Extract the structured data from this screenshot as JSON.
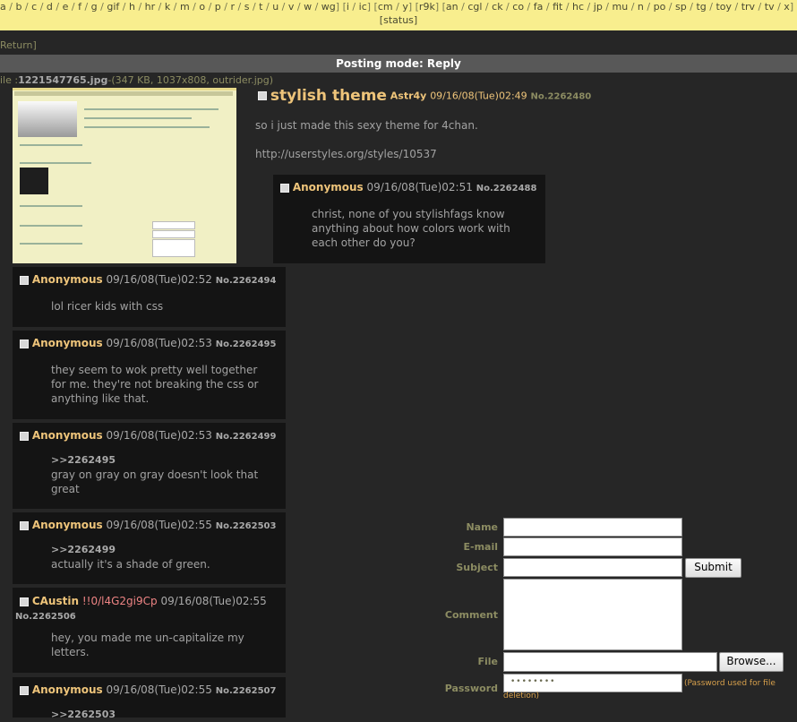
{
  "nav": {
    "boards_row1": [
      "a",
      "b",
      "c",
      "d",
      "e",
      "f",
      "g",
      "gif",
      "h",
      "hr",
      "k",
      "m",
      "o",
      "p",
      "r",
      "s",
      "t",
      "u",
      "v",
      "w",
      "wg",
      "i",
      "ic",
      "cm",
      "y",
      "r9k",
      "an",
      "cgl",
      "ck",
      "co",
      "fa",
      "fit",
      "hc",
      "jp",
      "mu",
      "n",
      "po",
      "sp",
      "tg",
      "toy",
      "trv",
      "tv",
      "x",
      "r"
    ],
    "status": "status"
  },
  "return_link": "Return",
  "mode_bar": "Posting mode: Reply",
  "file": {
    "label": "ile :",
    "name": "1221547765.jpg",
    "info": "-(347 KB, 1037x808, outrider.jpg)"
  },
  "op": {
    "subject": "stylish theme",
    "name": "Astr4y",
    "date": "09/16/08(Tue)02:49",
    "no": "No.2262480",
    "body_line1": "so i just made this sexy theme for 4chan.",
    "body_line2": "http://userstyles.org/styles/10537"
  },
  "replies": [
    {
      "name": "Anonymous",
      "date": "09/16/08(Tue)02:51",
      "no": "No.2262488",
      "quote": "",
      "lines": [
        "christ, none of you stylishfags know",
        "anything about how colors work with",
        "each other do you?"
      ]
    },
    {
      "name": "Anonymous",
      "date": "09/16/08(Tue)02:52",
      "no": "No.2262494",
      "quote": "",
      "lines": [
        "lol ricer kids with css"
      ]
    },
    {
      "name": "Anonymous",
      "date": "09/16/08(Tue)02:53",
      "no": "No.2262495",
      "quote": "",
      "lines": [
        "they seem to wok pretty well together",
        "for me. they're not breaking the css or",
        "anything like that."
      ]
    },
    {
      "name": "Anonymous",
      "date": "09/16/08(Tue)02:53",
      "no": "No.2262499",
      "quote": ">>2262495",
      "lines": [
        "gray on gray on gray doesn't look that",
        "great"
      ]
    },
    {
      "name": "Anonymous",
      "date": "09/16/08(Tue)02:55",
      "no": "No.2262503",
      "quote": ">>2262499",
      "lines": [
        "actually it's a shade of green."
      ]
    },
    {
      "name": "CAustin",
      "trip": "!!0/l4G2gi9Cp",
      "date": "09/16/08(Tue)02:55",
      "no": "No.2262506",
      "quote": "",
      "lines": [
        "hey, you made me un-capitalize my",
        "letters."
      ]
    },
    {
      "name": "Anonymous",
      "date": "09/16/08(Tue)02:55",
      "no": "No.2262507",
      "quote": ">>2262503",
      "lines": []
    }
  ],
  "form": {
    "name_label": "Name",
    "email_label": "E-mail",
    "subject_label": "Subject",
    "comment_label": "Comment",
    "file_label": "File",
    "password_label": "Password",
    "submit": "Submit",
    "browse": "Browse...",
    "password_value": "••••••••",
    "password_note": "(Password used for file deletion)"
  },
  "colors": {
    "background": "#262626",
    "nav_bg": "#f8ee8e",
    "post_bg": "#141414",
    "name": "#eec47a",
    "trip": "#ee8484"
  }
}
